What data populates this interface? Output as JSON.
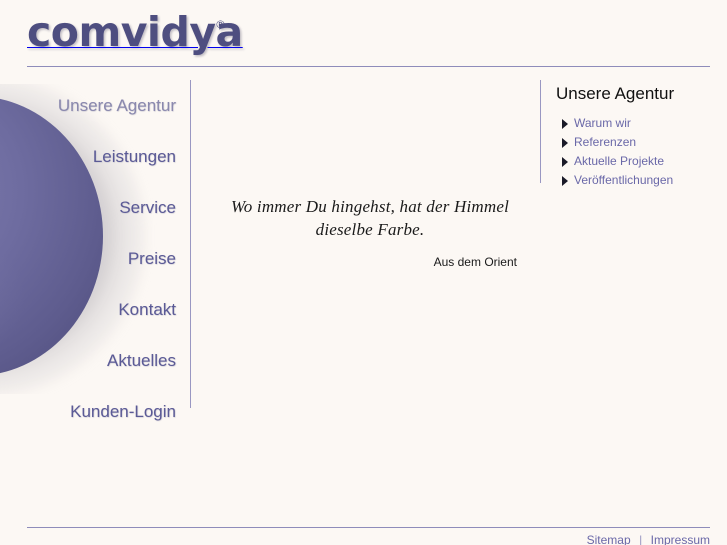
{
  "site": {
    "background_color": "#fcf8f4",
    "accent_color": "#5b5a96",
    "rule_color": "#8e8cba"
  },
  "header": {
    "logo_text": "comvidya",
    "logo_registered_mark": "®"
  },
  "nav": {
    "items": [
      {
        "label": "Unsere Agentur",
        "active": true
      },
      {
        "label": "Leistungen",
        "active": false
      },
      {
        "label": "Service",
        "active": false
      },
      {
        "label": "Preise",
        "active": false
      },
      {
        "label": "Kontakt",
        "active": false
      },
      {
        "label": "Aktuelles",
        "active": false
      },
      {
        "label": "Kunden-Login",
        "active": false
      }
    ]
  },
  "main": {
    "quote": "Wo immer Du hingehst, hat der Himmel dieselbe Farbe.",
    "quote_source": "Aus dem Orient"
  },
  "aside": {
    "title": "Unsere Agentur",
    "links": [
      {
        "label": "Warum wir",
        "icon": "triangle-right-icon"
      },
      {
        "label": "Referenzen",
        "icon": "triangle-right-icon"
      },
      {
        "label": "Aktuelle Projekte",
        "icon": "triangle-right-icon"
      },
      {
        "label": "Veröffentlichungen",
        "icon": "triangle-right-icon"
      }
    ]
  },
  "footer": {
    "sitemap_label": "Sitemap",
    "separator": "|",
    "imprint_label": "Impressum"
  }
}
